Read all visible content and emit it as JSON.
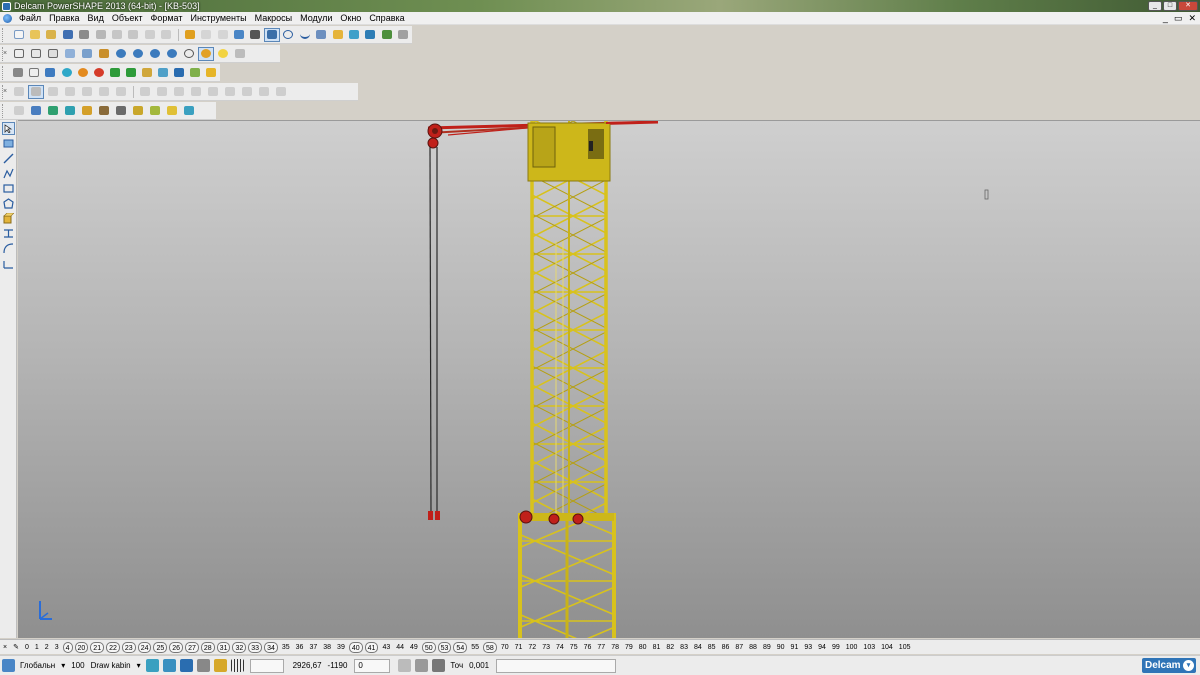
{
  "window": {
    "title": "Delcam PowerSHAPE 2013 (64-bit) - [KB-503]",
    "controls": {
      "minimize": "_",
      "maximize": "□",
      "close": "✕"
    }
  },
  "menu": {
    "items": [
      "Файл",
      "Правка",
      "Вид",
      "Объект",
      "Формат",
      "Инструменты",
      "Макросы",
      "Модули",
      "Окно",
      "Справка"
    ],
    "mdi_controls": {
      "minimize": "_",
      "restore": "▭",
      "close": "✕"
    }
  },
  "levels": {
    "items": [
      "0",
      "1",
      "2",
      "3",
      "4",
      "20",
      "21",
      "22",
      "23",
      "24",
      "25",
      "26",
      "27",
      "28",
      "31",
      "32",
      "33",
      "34",
      "35",
      "36",
      "37",
      "38",
      "39",
      "40",
      "41",
      "43",
      "44",
      "49",
      "50",
      "53",
      "54",
      "55",
      "58",
      "70",
      "71",
      "72",
      "73",
      "74",
      "75",
      "76",
      "77",
      "78",
      "79",
      "80",
      "81",
      "82",
      "83",
      "84",
      "85",
      "86",
      "87",
      "88",
      "89",
      "90",
      "91",
      "93",
      "94",
      "99",
      "100",
      "103",
      "104",
      "105"
    ],
    "boxed": [
      "4",
      "20",
      "21",
      "22",
      "23",
      "24",
      "25",
      "26",
      "27",
      "28",
      "31",
      "32",
      "33",
      "34",
      "40",
      "41",
      "50",
      "53",
      "54",
      "58"
    ]
  },
  "status": {
    "workplane": "Глобальн",
    "dropdown_arrow": "▾",
    "level_number": "100",
    "level_name": "Draw kabin",
    "coord_x": "2926,67",
    "coord_y": "-1190",
    "coord_z": "0",
    "tolerance_label": "Точ",
    "tolerance_value": "0,001",
    "brand": "Delcam"
  },
  "colors": {
    "crane_yellow": "#d8c21c",
    "crane_red": "#c0201a",
    "viewport_top": "#cfcfcf",
    "viewport_bottom": "#8f8f8f",
    "brand_blue": "#2f74b7"
  }
}
